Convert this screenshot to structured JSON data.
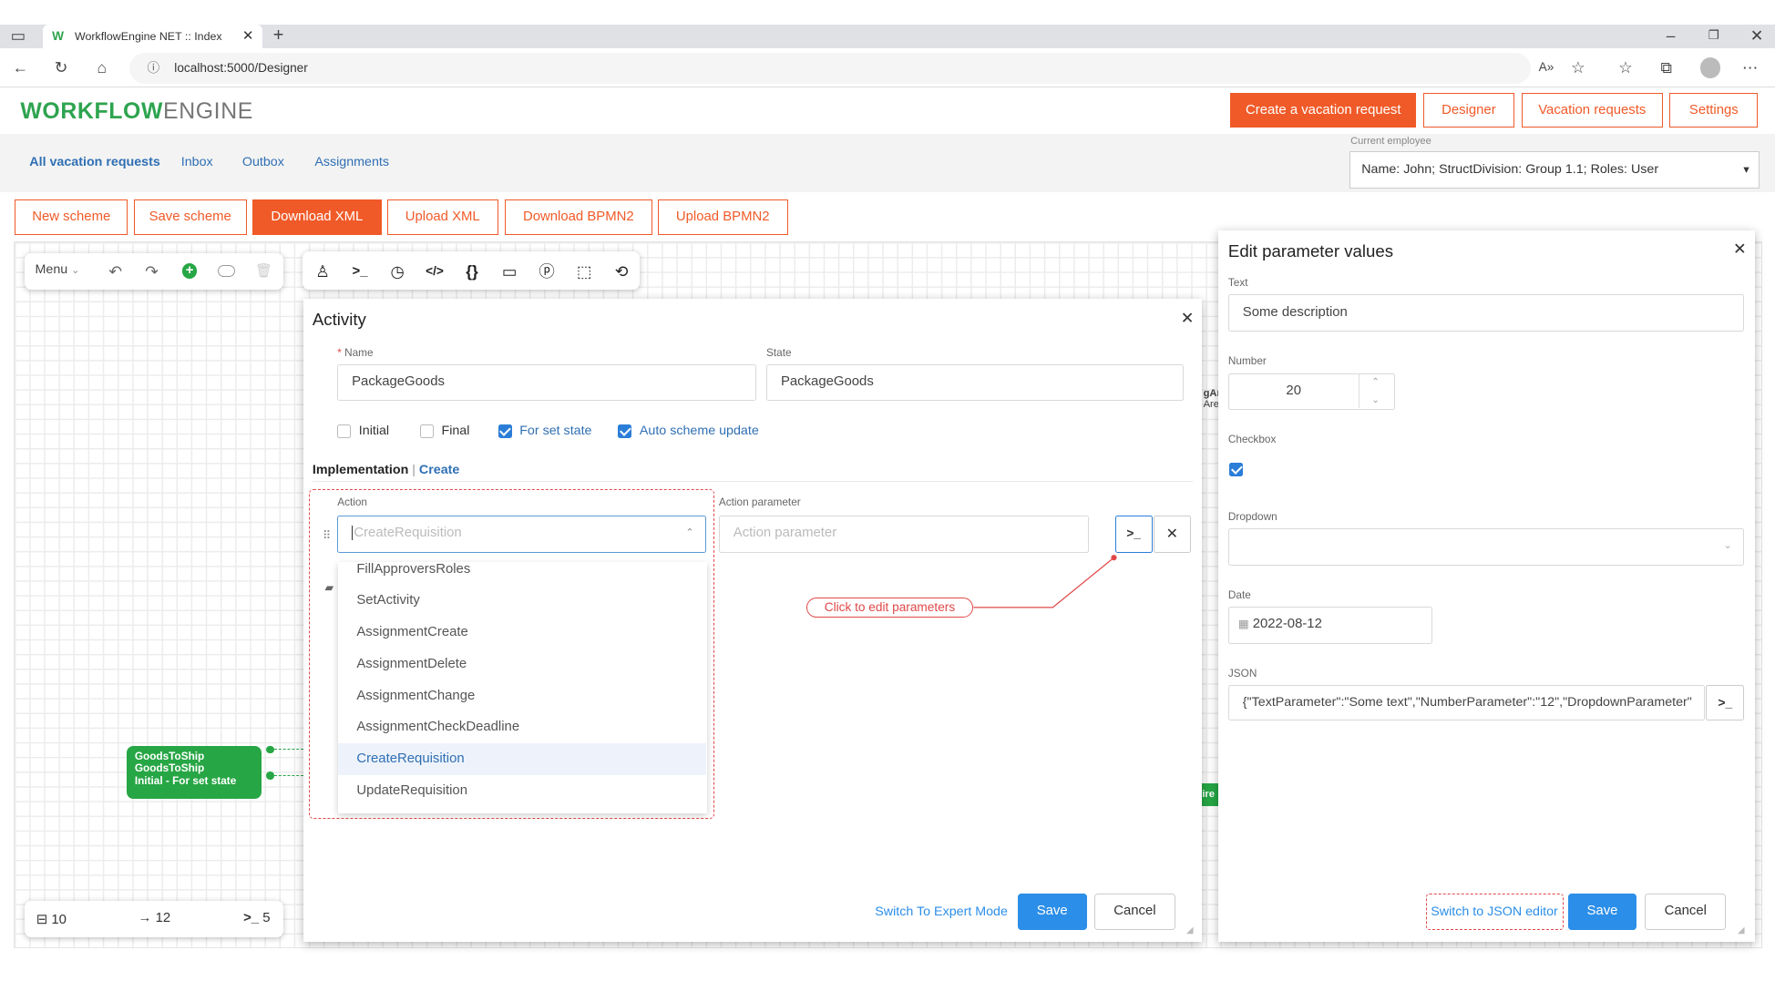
{
  "browser": {
    "tab_title": "WorkflowEngine NET :: Index",
    "url": "localhost:5000/Designer"
  },
  "header": {
    "logo_bold": "WORKFLOW",
    "logo_light": "ENGINE",
    "buttons": [
      "Create a vacation request",
      "Designer",
      "Vacation requests",
      "Settings"
    ]
  },
  "nav": {
    "links": [
      "All vacation requests",
      "Inbox",
      "Outbox",
      "Assignments"
    ],
    "employee_label": "Current employee",
    "employee_value": "Name: John; StructDivision: Group 1.1; Roles: User"
  },
  "toolbar": {
    "buttons": [
      "New scheme",
      "Save scheme",
      "Download XML",
      "Upload XML",
      "Download BPMN2",
      "Upload BPMN2"
    ]
  },
  "designer": {
    "menu_label": "Menu",
    "stats": {
      "activities": "10",
      "transitions": "12",
      "actions": "5"
    }
  },
  "node": {
    "line1": "GoodsToShip",
    "line2": "GoodsToShip",
    "line3": "Initial - For set state"
  },
  "partial_labels": {
    "a": "gAr",
    "b": "Are",
    "c": "ire"
  },
  "activity": {
    "title": "Activity",
    "name_label": "Name",
    "name_value": "PackageGoods",
    "state_label": "State",
    "state_value": "PackageGoods",
    "checkboxes": [
      {
        "label": "Initial",
        "checked": false
      },
      {
        "label": "Final",
        "checked": false
      },
      {
        "label": "For set state",
        "checked": true
      },
      {
        "label": "Auto scheme update",
        "checked": true
      }
    ],
    "implementation_label": "Implementation",
    "create_link": "Create",
    "action_label": "Action",
    "action_placeholder": "CreateRequisition",
    "action_param_label": "Action parameter",
    "action_param_placeholder": "Action parameter",
    "dropdown_items": [
      "FillApproversRoles",
      "SetActivity",
      "AssignmentCreate",
      "AssignmentDelete",
      "AssignmentChange",
      "AssignmentCheckDeadline",
      "CreateRequisition",
      "UpdateRequisition"
    ],
    "dropdown_selected": "CreateRequisition",
    "callout": "Click to edit parameters",
    "expert_mode_link": "Switch To Expert Mode",
    "save_label": "Save",
    "cancel_label": "Cancel"
  },
  "edit_params": {
    "title": "Edit parameter values",
    "text_label": "Text",
    "text_value": "Some description",
    "number_label": "Number",
    "number_value": "20",
    "checkbox_label": "Checkbox",
    "checkbox_checked": true,
    "dropdown_label": "Dropdown",
    "dropdown_value": "",
    "date_label": "Date",
    "date_value": "2022-08-12",
    "json_label": "JSON",
    "json_value": "{\"TextParameter\":\"Some text\",\"NumberParameter\":\"12\",\"DropdownParameter\"",
    "json_editor_link": "Switch to JSON editor",
    "save_label": "Save",
    "cancel_label": "Cancel"
  },
  "colors": {
    "accent": "#f05a28",
    "link": "#2f6fb4",
    "primary_blue": "#2b8ee8",
    "node_green": "#27a645",
    "callout_red": "#e04848"
  }
}
